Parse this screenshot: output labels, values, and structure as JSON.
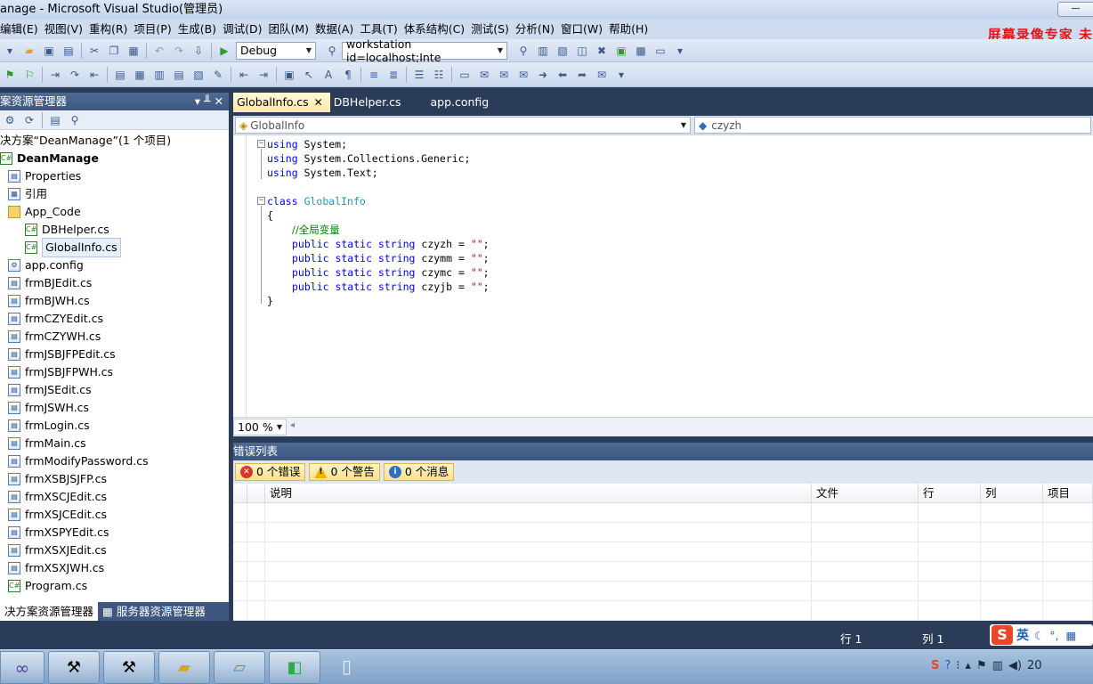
{
  "window": {
    "title": "anage - Microsoft Visual Studio(管理员)",
    "minimize_glyph": "—"
  },
  "menu": [
    "编辑(E)",
    "视图(V)",
    "重构(R)",
    "项目(P)",
    "生成(B)",
    "调试(D)",
    "团队(M)",
    "数据(A)",
    "工具(T)",
    "体系结构(C)",
    "测试(S)",
    "分析(N)",
    "窗口(W)",
    "帮助(H)"
  ],
  "watermark": "屏幕录像专家 未",
  "toolbar": {
    "config": "Debug",
    "connection": "workstation id=localhost;Inte"
  },
  "solution_explorer": {
    "title": "案资源管理器",
    "pin_glyph": "▾ ╨ ✕",
    "solution": "决方案“DeanManage”(1 个项目)",
    "project": "DeanManage",
    "items": [
      {
        "label": "Properties",
        "icon": "properties-icon",
        "indent": 1
      },
      {
        "label": "引用",
        "icon": "references-icon",
        "indent": 1
      },
      {
        "label": "App_Code",
        "icon": "folder-open-icon",
        "indent": 1
      },
      {
        "label": "DBHelper.cs",
        "icon": "cs-file-icon",
        "indent": 2
      },
      {
        "label": "GlobalInfo.cs",
        "icon": "cs-file-icon",
        "indent": 2,
        "selected": true
      },
      {
        "label": "app.config",
        "icon": "config-file-icon",
        "indent": 1
      },
      {
        "label": "frmBJEdit.cs",
        "icon": "form-icon",
        "indent": 1
      },
      {
        "label": "frmBJWH.cs",
        "icon": "form-icon",
        "indent": 1
      },
      {
        "label": "frmCZYEdit.cs",
        "icon": "form-icon",
        "indent": 1
      },
      {
        "label": "frmCZYWH.cs",
        "icon": "form-icon",
        "indent": 1
      },
      {
        "label": "frmJSBJFPEdit.cs",
        "icon": "form-icon",
        "indent": 1
      },
      {
        "label": "frmJSBJFPWH.cs",
        "icon": "form-icon",
        "indent": 1
      },
      {
        "label": "frmJSEdit.cs",
        "icon": "form-icon",
        "indent": 1
      },
      {
        "label": "frmJSWH.cs",
        "icon": "form-icon",
        "indent": 1
      },
      {
        "label": "frmLogin.cs",
        "icon": "form-icon",
        "indent": 1
      },
      {
        "label": "frmMain.cs",
        "icon": "form-icon",
        "indent": 1
      },
      {
        "label": "frmModifyPassword.cs",
        "icon": "form-icon",
        "indent": 1
      },
      {
        "label": "frmXSBJSJFP.cs",
        "icon": "form-icon",
        "indent": 1
      },
      {
        "label": "frmXSCJEdit.cs",
        "icon": "form-icon",
        "indent": 1
      },
      {
        "label": "frmXSJCEdit.cs",
        "icon": "form-icon",
        "indent": 1
      },
      {
        "label": "frmXSPYEdit.cs",
        "icon": "form-icon",
        "indent": 1
      },
      {
        "label": "frmXSXJEdit.cs",
        "icon": "form-icon",
        "indent": 1
      },
      {
        "label": "frmXSXJWH.cs",
        "icon": "form-icon",
        "indent": 1
      },
      {
        "label": "Program.cs",
        "icon": "cs-file-icon",
        "indent": 1
      }
    ],
    "bottom_tabs": [
      "决方案资源管理器",
      "服务器资源管理器"
    ]
  },
  "editor": {
    "tabs": [
      {
        "label": "GlobalInfo.cs",
        "active": true
      },
      {
        "label": "DBHelper.cs",
        "active": false
      },
      {
        "label": "app.config",
        "active": false
      }
    ],
    "nav_left": "GlobalInfo",
    "nav_right": "czyzh",
    "code": {
      "l1": [
        "using",
        " System;"
      ],
      "l2": [
        "using",
        " System.Collections.Generic;"
      ],
      "l3": [
        "using",
        " System.Text;"
      ],
      "l5": [
        "class",
        " ",
        "GlobalInfo"
      ],
      "l6": "{",
      "l7": "//全局变量",
      "fields": [
        "czyzh",
        "czymm",
        "czymc",
        "czyjb"
      ],
      "field_prefix": "public static string ",
      "field_suffix": " = ",
      "string_literal": "\"\"",
      "semicolon": ";",
      "l12": "}"
    },
    "zoom": "100 %"
  },
  "error_list": {
    "title": "错误列表",
    "filters": [
      {
        "label": "0 个错误",
        "icon": "error-icon",
        "color": "#d9352b",
        "glyph": "✕"
      },
      {
        "label": "0 个警告",
        "icon": "warning-icon",
        "color": "#f0b400",
        "glyph": "!"
      },
      {
        "label": "0 个消息",
        "icon": "info-icon",
        "color": "#2f6fc0",
        "glyph": "i"
      }
    ],
    "columns": [
      "说明",
      "文件",
      "行",
      "列",
      "项目"
    ]
  },
  "status": {
    "row": "行 1",
    "col": "列 1",
    "ime_lang": "英"
  },
  "taskbar": {
    "clock": "20"
  }
}
